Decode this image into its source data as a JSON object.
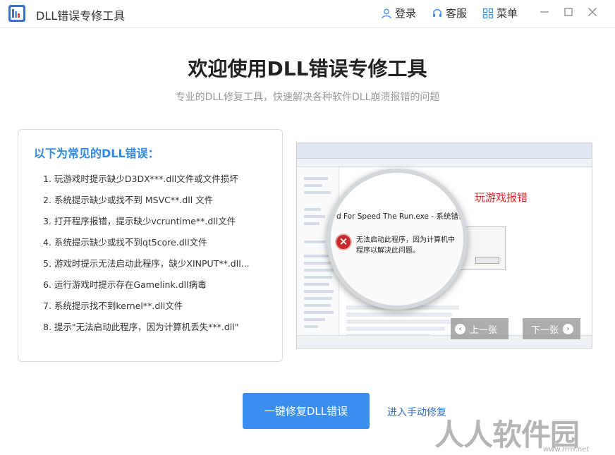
{
  "window": {
    "title": "DLL错误专修工具",
    "login_label": "登录",
    "service_label": "客服",
    "menu_label": "菜单"
  },
  "hero": {
    "title": "欢迎使用DLL错误专修工具",
    "subtitle": "专业的DLL修复工具，快速解决各种软件DLL崩溃报错的问题"
  },
  "errors": {
    "heading": "以下为常见的DLL错误：",
    "items": [
      "1. 玩游戏时提示缺少D3DX***.dll文件或文件损坏",
      "2. 系统提示缺少或找不到 MSVC**.dll 文件",
      "3. 打开程序报错，提示缺少vcruntime**.dll文件",
      "4. 系统提示缺少或找不到qt5core.dll文件",
      "5. 游戏时提示无法启动此程序，缺少XINPUT**.dll...",
      "6. 运行游戏时提示存在Gamelink.dll病毒",
      "7. 系统提示找不到kernel**.dll文件",
      "8. 提示\"无法启动此程序，因为计算机丢失***.dll\""
    ]
  },
  "slide": {
    "tag": "玩游戏报错",
    "dialog_title": "d For Speed The Run.exe - 系统错误",
    "dialog_msg_1": "无法启动此程序，因为计算机中",
    "dialog_msg_2": "程序以解决此问题。",
    "prev_label": "上一张",
    "next_label": "下一张"
  },
  "actions": {
    "fix_button": "一键修复DLL错误",
    "manual_link": "进入手动修复"
  },
  "watermark": {
    "text": "人人软件园",
    "url": "www.rrrrr.net"
  },
  "colors": {
    "accent": "#3a8ef0",
    "heading_blue": "#2f8ae5",
    "error_red": "#e12b2b"
  }
}
